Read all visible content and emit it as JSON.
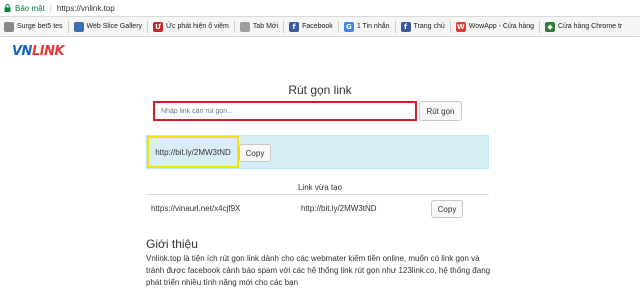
{
  "browser": {
    "secure_label": "Bảo mật",
    "url": "https://vnlink.top",
    "bookmarks": [
      {
        "label": "Surge bet5 tes",
        "icon": "page-icon",
        "color": "#888888"
      },
      {
        "label": "Web Slice Gallery",
        "icon": "page-icon",
        "color": "#3a6fb0"
      },
      {
        "label": "Ức phát hiện ổ viêm",
        "icon": "red-square-icon",
        "color": "#c62828"
      },
      {
        "label": "Tab Mới",
        "icon": "page-icon",
        "color": "#9e9e9e"
      },
      {
        "label": "Facebook",
        "icon": "facebook-icon",
        "color": "#3b5998"
      },
      {
        "label": "1 Tin nhắn",
        "icon": "google-icon",
        "color": "#4285f4"
      },
      {
        "label": "Trang chủ",
        "icon": "facebook-icon",
        "color": "#3b5998"
      },
      {
        "label": "WowApp - Cửa hàng",
        "icon": "wowapp-icon",
        "color": "#e53935"
      },
      {
        "label": "Cửa hàng Chrome tr",
        "icon": "chrome-store-icon",
        "color": "#2e7d32"
      }
    ]
  },
  "site": {
    "logo_part1": "VN",
    "logo_part2": "LINK"
  },
  "main": {
    "title": "Rút gọn link",
    "input_placeholder": "Nhập link cần rút gọn...",
    "shorten_button": "Rút gọn",
    "result_link": "http://bit.ly/2MW3tND",
    "copy_button": "Copy",
    "recent_title": "Link vừa tạo",
    "recent_short": "https://vinaurl.net/x4cjf9X",
    "recent_original": "http://bit.ly/2MW3tND",
    "recent_copy_button": "Copy",
    "intro_title": "Giới thiệu",
    "intro_text": "Vnlink.top là tiện ích rút gọn link dành cho các webmater kiếm tiền online, muốn có link gọn và tránh được facebook cảnh báo spam với các hệ thống link rút gọn như 123link.co, hệ thống đang phát triển nhiều tính năng mới cho các bạn"
  },
  "colors": {
    "input_highlight": "#d0202a",
    "result_highlight": "#f2e600",
    "result_panel_bg": "#d9edf7",
    "logo_blue": "#1565c0",
    "logo_red": "#e53935"
  }
}
